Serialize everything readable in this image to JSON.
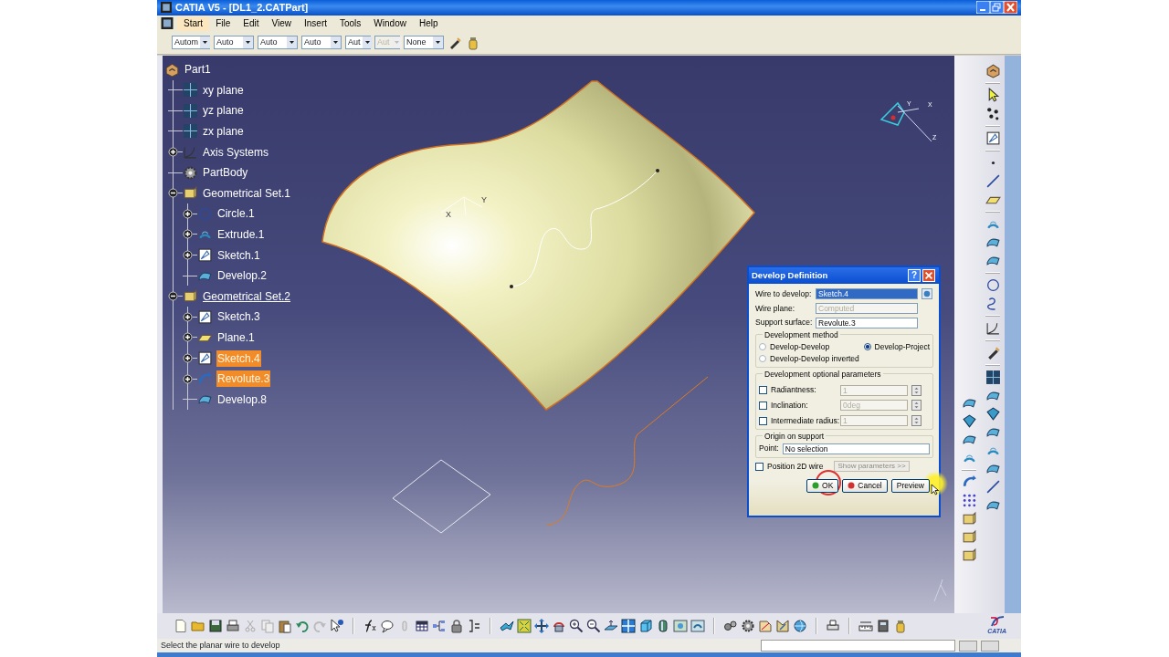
{
  "window": {
    "title": "CATIA V5 - [DL1_2.CATPart]"
  },
  "menu": [
    {
      "label": "Start",
      "selected": true
    },
    {
      "label": "File",
      "selected": false
    },
    {
      "label": "Edit",
      "selected": false
    },
    {
      "label": "View",
      "selected": false
    },
    {
      "label": "Insert",
      "selected": false
    },
    {
      "label": "Tools",
      "selected": false
    },
    {
      "label": "Window",
      "selected": false
    },
    {
      "label": "Help",
      "selected": false
    }
  ],
  "toolbar_dropdowns": [
    {
      "value": "Autom",
      "disabled": false
    },
    {
      "value": "Auto",
      "disabled": false
    },
    {
      "value": "Auto",
      "disabled": false
    },
    {
      "value": "Auto",
      "disabled": false
    },
    {
      "value": "Aut",
      "disabled": false
    },
    {
      "value": "Aut",
      "disabled": true
    },
    {
      "value": "None",
      "disabled": false
    }
  ],
  "tree": {
    "label": "Part1",
    "kind": "part",
    "selected": false,
    "in_work": false,
    "children": [
      {
        "label": "xy plane",
        "kind": "plane",
        "selected": false,
        "in_work": false
      },
      {
        "label": "yz plane",
        "kind": "plane",
        "selected": false,
        "in_work": false
      },
      {
        "label": "zx plane",
        "kind": "plane",
        "selected": false,
        "in_work": false
      },
      {
        "label": "Axis Systems",
        "kind": "axis",
        "expanded": false,
        "selected": false,
        "in_work": false
      },
      {
        "label": "PartBody",
        "kind": "body",
        "selected": false,
        "in_work": false
      },
      {
        "label": "Geometrical Set.1",
        "kind": "set",
        "expanded": true,
        "selected": false,
        "in_work": false,
        "children": [
          {
            "label": "Circle.1",
            "kind": "circle",
            "expanded": false,
            "selected": false,
            "in_work": false
          },
          {
            "label": "Extrude.1",
            "kind": "extrude",
            "expanded": false,
            "selected": false,
            "in_work": false
          },
          {
            "label": "Sketch.1",
            "kind": "sketch",
            "expanded": false,
            "selected": false,
            "in_work": false
          },
          {
            "label": "Develop.2",
            "kind": "develop",
            "selected": false,
            "in_work": false
          }
        ]
      },
      {
        "label": "Geometrical Set.2",
        "kind": "set",
        "expanded": true,
        "selected": false,
        "in_work": true,
        "children": [
          {
            "label": "Sketch.3",
            "kind": "sketch",
            "expanded": false,
            "selected": false,
            "in_work": false
          },
          {
            "label": "Plane.1",
            "kind": "planefeature",
            "expanded": false,
            "selected": false,
            "in_work": false
          },
          {
            "label": "Sketch.4",
            "kind": "sketch",
            "expanded": false,
            "selected": true,
            "in_work": false
          },
          {
            "label": "Revolute.3",
            "kind": "revolute",
            "expanded": false,
            "selected": true,
            "in_work": false
          },
          {
            "label": "Develop.8",
            "kind": "develop",
            "selected": false,
            "in_work": false
          }
        ]
      }
    ]
  },
  "axis_labels": {
    "surface": [
      "X",
      "Y"
    ],
    "compass": [
      "Y",
      "X",
      "Z"
    ]
  },
  "dialog": {
    "title": "Develop Definition",
    "help": "?",
    "fields": [
      {
        "label": "Wire to develop:",
        "value": "Sketch.4",
        "selected": true,
        "disabled": false,
        "picker": true
      },
      {
        "label": "Wire plane:",
        "value": "Computed",
        "selected": false,
        "disabled": true,
        "picker": false
      },
      {
        "label": "Support surface:",
        "value": "Revolute.3",
        "selected": false,
        "disabled": false,
        "picker": false
      }
    ],
    "method": {
      "title": "Development method",
      "options": [
        {
          "label": "Develop-Develop",
          "selected": false
        },
        {
          "label": "Develop-Project",
          "selected": true
        },
        {
          "label": "Develop-Develop inverted",
          "selected": false
        }
      ]
    },
    "optional": {
      "title": "Development optional parameters",
      "params": [
        {
          "label": "Radiantness:",
          "value": "1",
          "checked": false,
          "disabled": true
        },
        {
          "label": "Inclination:",
          "value": "0deg",
          "checked": false,
          "disabled": true
        },
        {
          "label": "Intermediate radius:",
          "value": "1",
          "checked": false,
          "disabled": true
        }
      ]
    },
    "origin": {
      "title": "Origin on support",
      "label": "Point:",
      "value": "No selection"
    },
    "position_2d": {
      "label": "Position 2D wire",
      "checked": false
    },
    "show_parameters": {
      "label": "Show parameters >>",
      "disabled": true
    },
    "buttons": [
      {
        "label": "OK",
        "kind": "ok"
      },
      {
        "label": "Cancel",
        "kind": "cancel"
      },
      {
        "label": "Preview",
        "kind": "preview"
      }
    ]
  },
  "logo": "CATIA",
  "status_bar": {
    "message": "Select the planar wire to develop"
  }
}
